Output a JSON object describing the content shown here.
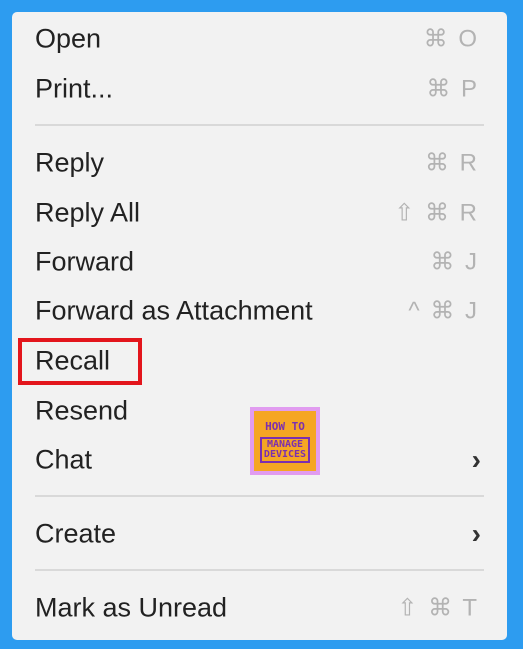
{
  "menu": {
    "items": [
      {
        "label": "Open",
        "shortcut": "⌘ O"
      },
      {
        "label": "Print...",
        "shortcut": "⌘ P"
      },
      {
        "label": "Reply",
        "shortcut": "⌘ R"
      },
      {
        "label": "Reply All",
        "shortcut": "⇧ ⌘ R"
      },
      {
        "label": "Forward",
        "shortcut": "⌘ J"
      },
      {
        "label": "Forward as Attachment",
        "shortcut": "^ ⌘ J"
      },
      {
        "label": "Recall"
      },
      {
        "label": "Resend"
      },
      {
        "label": "Chat",
        "submenu": "›"
      },
      {
        "label": "Create",
        "submenu": "›"
      },
      {
        "label": "Mark as Unread",
        "shortcut": "⇧ ⌘ T"
      }
    ]
  },
  "logo": {
    "top": "HOW TO",
    "bottom_line1": "MANAGE",
    "bottom_line2": "DEVICES"
  },
  "colors": {
    "background": "#2d9cf0",
    "menu_bg": "#f2f2f2",
    "highlight": "#e3151c"
  }
}
